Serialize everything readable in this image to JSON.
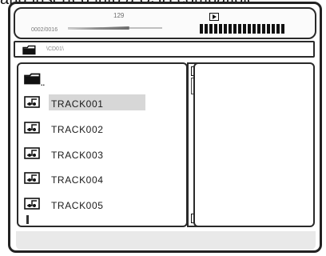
{
  "caption": {
    "text": "and inserted into a USB compatible"
  },
  "status": {
    "track_number": "129",
    "play_time": "0002/0016",
    "progress": 0.65,
    "level_bars": 18,
    "play_icon": "play-icon"
  },
  "path": {
    "icon": "folder-icon",
    "text": "\\CD01\\"
  },
  "file_list": {
    "parent": {
      "icon": "folder-up-icon",
      "label": ".."
    },
    "items": [
      {
        "label": "TRACK001",
        "icon": "audio-file-icon",
        "selected": true
      },
      {
        "label": "TRACK002",
        "icon": "audio-file-icon",
        "selected": false
      },
      {
        "label": "TRACK003",
        "icon": "audio-file-icon",
        "selected": false
      },
      {
        "label": "TRACK004",
        "icon": "audio-file-icon",
        "selected": false
      },
      {
        "label": "TRACK005",
        "icon": "audio-file-icon",
        "selected": false
      }
    ]
  },
  "scrollbar": {
    "up_icon": "arrow-up-icon",
    "down_icon": "arrow-down-icon"
  },
  "colors": {
    "outline": "#222222",
    "selection": "#d7d7d7",
    "status_bar": "#e9e9e9"
  }
}
